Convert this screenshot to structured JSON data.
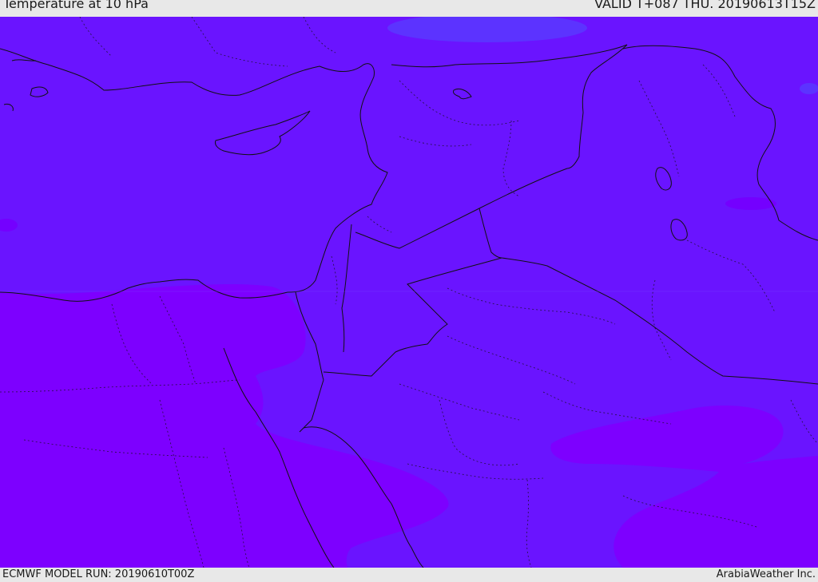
{
  "header": {
    "title": "Temperature at 10 hPa",
    "valid_time": "VALID T+087 THU. 20190613T15Z"
  },
  "footer": {
    "model_run": "ECMWF MODEL RUN: 20190610T00Z",
    "credit": "ArabiaWeather Inc."
  },
  "map": {
    "variable": "Temperature",
    "level": "10 hPa",
    "fill_colors": {
      "base": "#6a14ff",
      "warm_violet": "#7d00ff",
      "cool_blue": "#5c33ff"
    },
    "border_color": "#111111"
  }
}
